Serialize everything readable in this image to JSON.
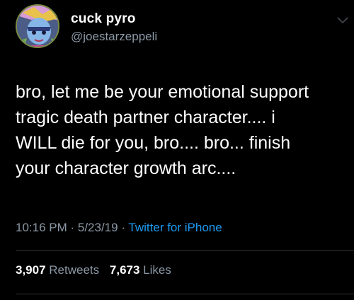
{
  "user": {
    "display_name": "cuck pyro",
    "handle": "@joestarzeppeli",
    "avatar_icon": "anime-character-avatar"
  },
  "tweet": {
    "text": "bro, let me be your emotional support\ntragic death partner character.... i\nWILL die for you, bro.... bro... finish\nyour character growth arc...."
  },
  "meta": {
    "time": "10:16 PM",
    "separator": " · ",
    "date": "5/23/19",
    "source": "Twitter for iPhone"
  },
  "stats": {
    "retweets_count": "3,907",
    "retweets_label": "Retweets",
    "likes_count": "7,673",
    "likes_label": "Likes"
  },
  "colors": {
    "background": "#000000",
    "text": "#ffffff",
    "secondary": "#8b98a5",
    "link": "#1d9bf0",
    "divider": "#2f3336"
  }
}
